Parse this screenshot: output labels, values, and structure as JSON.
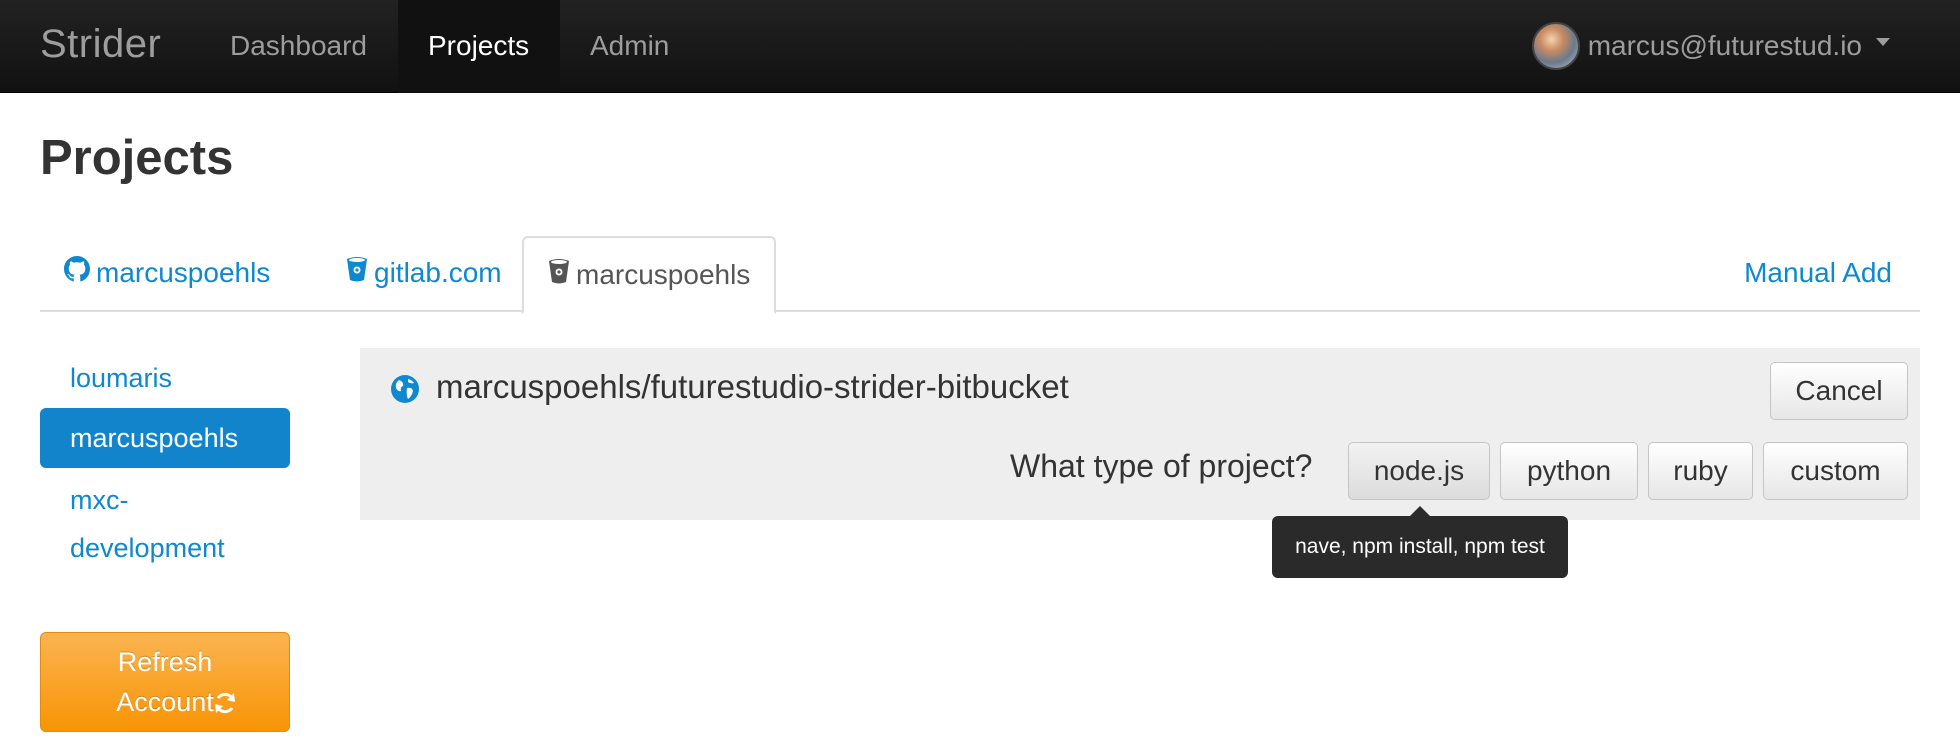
{
  "navbar": {
    "brand": "Strider",
    "items": [
      {
        "label": "Dashboard",
        "active": false
      },
      {
        "label": "Projects",
        "active": true
      },
      {
        "label": "Admin",
        "active": false
      }
    ],
    "user_email": "marcus@futurestud.io"
  },
  "page": {
    "title": "Projects"
  },
  "tabs": {
    "items": [
      {
        "label": "marcuspoehls",
        "icon": "github-icon",
        "active": false
      },
      {
        "label": "gitlab.com",
        "icon": "bucket-icon",
        "active": false
      },
      {
        "label": "marcuspoehls",
        "icon": "bucket-icon",
        "active": true
      }
    ],
    "manual_add": "Manual Add"
  },
  "sidebar": {
    "accounts": [
      {
        "label": "loumaris",
        "active": false
      },
      {
        "label": "marcuspoehls",
        "active": true
      },
      {
        "label": "mxc-development",
        "active": false
      }
    ],
    "refresh_label": "Refresh Account",
    "refresh_icon": "refresh-icon"
  },
  "repo": {
    "name": "marcuspoehls/futurestudio-strider-bitbucket",
    "icon": "globe-icon",
    "cancel_label": "Cancel",
    "question": "What type of project?",
    "types": [
      "node.js",
      "python",
      "ruby",
      "custom"
    ],
    "tooltip": "nave, npm install, npm test"
  },
  "colors": {
    "link": "#0e88d0",
    "active_account": "#1184cc",
    "refresh_button": "#f89406",
    "navbar": "#1a1a1a"
  }
}
